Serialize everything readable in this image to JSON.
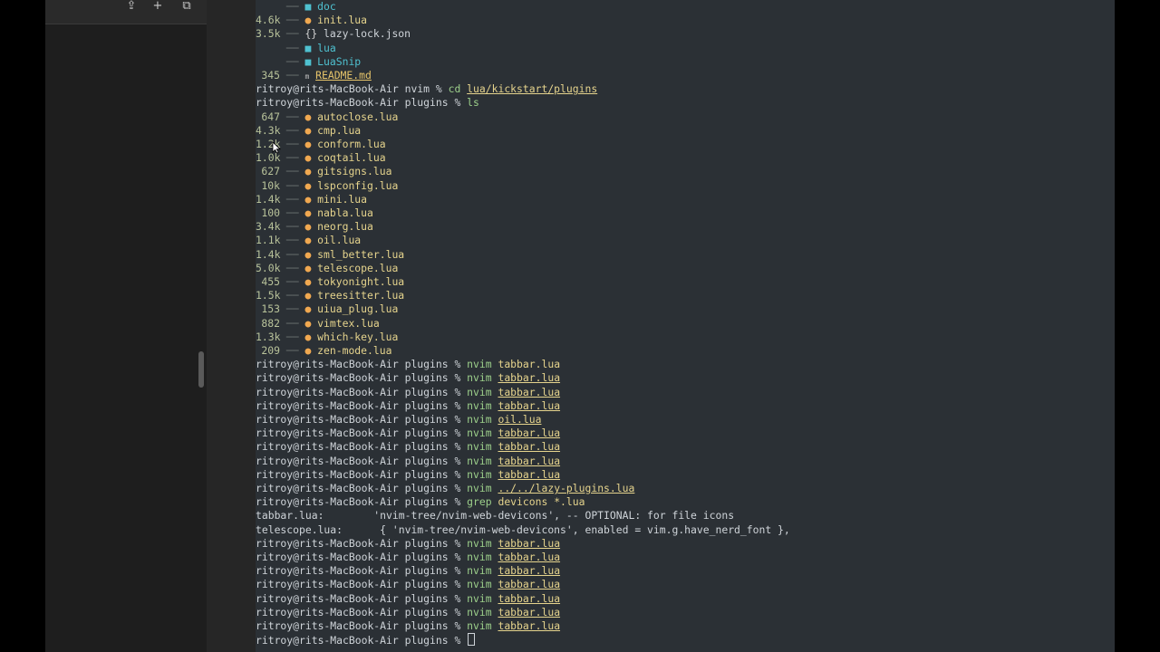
{
  "sidebar": {
    "toolbar_icons": [
      "share-icon",
      "plus-icon",
      "tabs-overview-icon"
    ],
    "toolbar_glyphs": [
      "⇪",
      "+",
      "⧉"
    ]
  },
  "terminal": {
    "prompt_plugins": "ritroy@rits-MacBook-Air plugins % ",
    "prompt_nvim": "ritroy@rits-MacBook-Air nvim % ",
    "tree_branch": " ── ",
    "top_entries": [
      {
        "size": "",
        "name": "doc",
        "kind": "dir"
      },
      {
        "size": "4.6k",
        "name": "init.lua",
        "kind": "lua"
      },
      {
        "size": "3.5k",
        "name": "lazy-lock.json",
        "kind": "json"
      },
      {
        "size": "",
        "name": "lua",
        "kind": "dir"
      },
      {
        "size": "",
        "name": "LuaSnip",
        "kind": "dir"
      },
      {
        "size": "345",
        "name": "README.md",
        "kind": "md"
      }
    ],
    "cd_command": {
      "cmd": "cd",
      "arg": "lua/kickstart/plugins"
    },
    "ls_command": {
      "cmd": "ls"
    },
    "plugin_files": [
      {
        "size": "647",
        "name": "autoclose.lua"
      },
      {
        "size": "4.3k",
        "name": "cmp.lua"
      },
      {
        "size": "1.2k",
        "name": "conform.lua"
      },
      {
        "size": "1.0k",
        "name": "coqtail.lua"
      },
      {
        "size": "627",
        "name": "gitsigns.lua"
      },
      {
        "size": "10k",
        "name": "lspconfig.lua"
      },
      {
        "size": "1.4k",
        "name": "mini.lua"
      },
      {
        "size": "100",
        "name": "nabla.lua"
      },
      {
        "size": "3.4k",
        "name": "neorg.lua"
      },
      {
        "size": "1.1k",
        "name": "oil.lua"
      },
      {
        "size": "1.4k",
        "name": "sml_better.lua"
      },
      {
        "size": "5.0k",
        "name": "telescope.lua"
      },
      {
        "size": "455",
        "name": "tokyonight.lua"
      },
      {
        "size": "1.5k",
        "name": "treesitter.lua"
      },
      {
        "size": "153",
        "name": "uiua_plug.lua"
      },
      {
        "size": "882",
        "name": "vimtex.lua"
      },
      {
        "size": "1.3k",
        "name": "which-key.lua"
      },
      {
        "size": "209",
        "name": "zen-mode.lua"
      }
    ],
    "history": [
      {
        "cmd": "nvim",
        "arg": "tabbar.lua",
        "underline": false
      },
      {
        "cmd": "nvim",
        "arg": "tabbar.lua",
        "underline": true
      },
      {
        "cmd": "nvim",
        "arg": "tabbar.lua",
        "underline": true
      },
      {
        "cmd": "nvim",
        "arg": "tabbar.lua",
        "underline": true
      },
      {
        "cmd": "nvim",
        "arg": "oil.lua",
        "underline": true
      },
      {
        "cmd": "nvim",
        "arg": "tabbar.lua",
        "underline": true
      },
      {
        "cmd": "nvim",
        "arg": "tabbar.lua",
        "underline": true
      },
      {
        "cmd": "nvim",
        "arg": "tabbar.lua",
        "underline": true
      },
      {
        "cmd": "nvim",
        "arg": "tabbar.lua",
        "underline": true
      },
      {
        "cmd": "nvim",
        "arg": "../../lazy-plugins.lua",
        "underline": true
      },
      {
        "cmd": "grep",
        "arg": "devicons *.lua",
        "underline": false
      }
    ],
    "grep_output": [
      "tabbar.lua:        'nvim-tree/nvim-web-devicons', -- OPTIONAL: for file icons",
      "telescope.lua:      { 'nvim-tree/nvim-web-devicons', enabled = vim.g.have_nerd_font },"
    ],
    "history2": [
      {
        "cmd": "nvim",
        "arg": "tabbar.lua",
        "underline": true
      },
      {
        "cmd": "nvim",
        "arg": "tabbar.lua",
        "underline": true
      },
      {
        "cmd": "nvim",
        "arg": "tabbar.lua",
        "underline": true
      },
      {
        "cmd": "nvim",
        "arg": "tabbar.lua",
        "underline": true
      },
      {
        "cmd": "nvim",
        "arg": "tabbar.lua",
        "underline": true
      },
      {
        "cmd": "nvim",
        "arg": "tabbar.lua",
        "underline": true
      },
      {
        "cmd": "nvim",
        "arg": "tabbar.lua",
        "underline": true
      }
    ]
  }
}
